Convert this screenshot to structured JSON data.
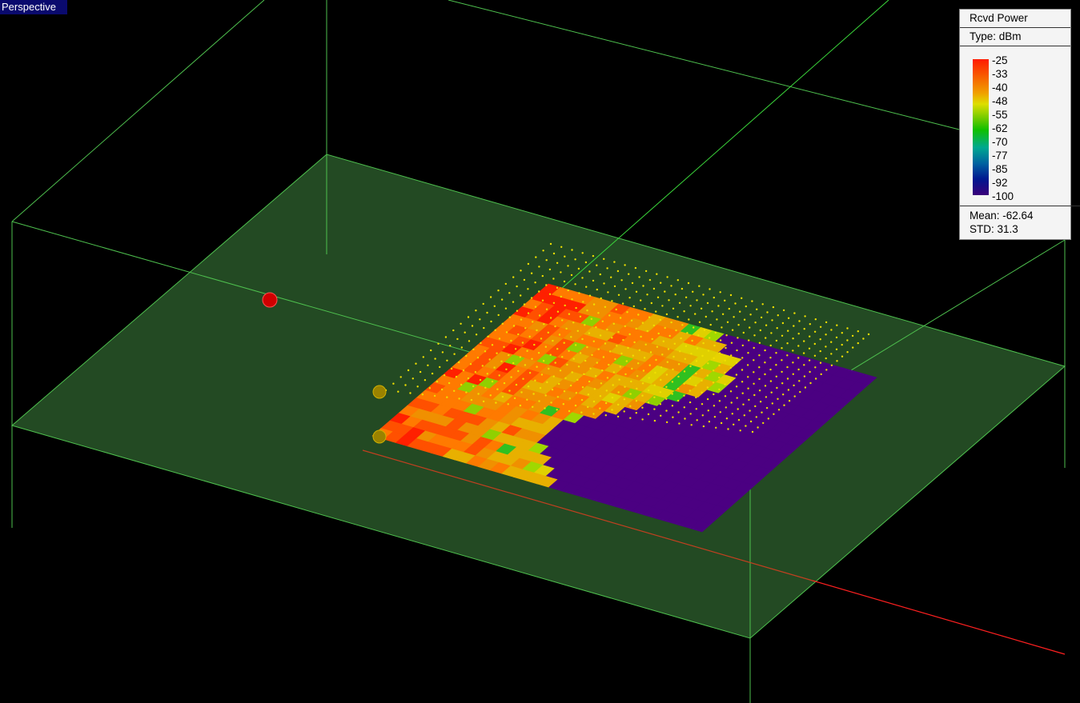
{
  "view": {
    "label": "Perspective"
  },
  "legend": {
    "title": "Rcvd Power",
    "type": "Type: dBm",
    "ticks": [
      "-25",
      "-33",
      "-40",
      "-48",
      "-55",
      "-62",
      "-70",
      "-77",
      "-85",
      "-92",
      "-100"
    ],
    "mean": "Mean: -62.64",
    "std": "STD: 31.3"
  },
  "colors": {
    "floor": "#234a23",
    "edges": "#4ec04e",
    "transmitter": "#d00000",
    "receiver": "#b89a00",
    "route_points": "#f0e000",
    "axis": "#ff2020",
    "no_signal": "#4b0082"
  }
}
